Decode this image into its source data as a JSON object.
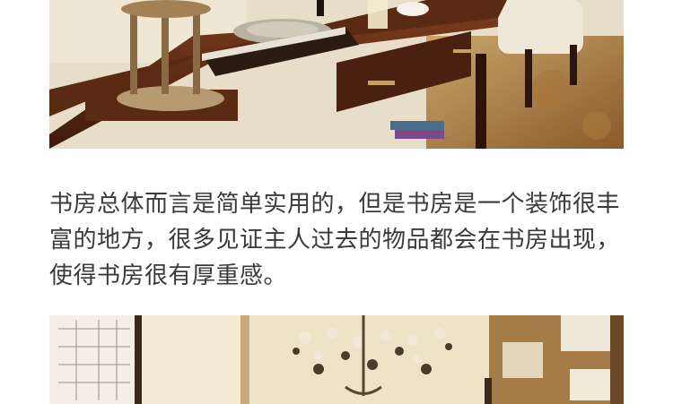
{
  "caption": "书房总体而言是简单实用的，但是书房是一个装饰很丰富的地方，很多见证主人过去的物品都会在书房出现，使得书房很有厚重感。",
  "photos": [
    {
      "subject": "dark-wood-coffee-table-photo"
    },
    {
      "subject": "crystal-chandelier-and-corkboard-photo"
    }
  ],
  "colors": {
    "background": "#ffffff",
    "text": "#3a3a3a"
  }
}
